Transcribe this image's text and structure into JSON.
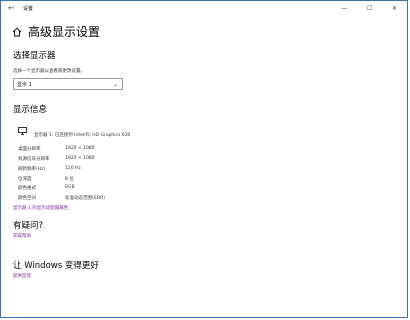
{
  "titlebar": {
    "back_glyph": "←",
    "title": "设置",
    "minimize_glyph": "—",
    "maximize_glyph": "☐",
    "close_glyph": "✕"
  },
  "header": {
    "title": "高级显示设置"
  },
  "select_display": {
    "heading": "选择显示器",
    "hint": "选择一个显示器以查看或更改设置。",
    "selected": "显示 1",
    "chevron": "⌄"
  },
  "display_info": {
    "heading": "显示信息",
    "display_name": "显示器 1: 已连接到 Intel(R) HD Graphics 630",
    "rows": [
      {
        "label": "桌面分辨率",
        "value": "1920 × 1080"
      },
      {
        "label": "有源信号分辨率",
        "value": "1920 × 1080"
      },
      {
        "label": "刷新频率(Hz)",
        "value": "120 Hz"
      },
      {
        "label": "位深度",
        "value": "8 位"
      },
      {
        "label": "颜色格式",
        "value": "RGB"
      },
      {
        "label": "颜色空间",
        "value": "标准动态范围(SDR)"
      }
    ],
    "adapter_link": "显示器 1 的显示适配器属性"
  },
  "help": {
    "heading": "有疑问?",
    "link": "获取帮助"
  },
  "improve": {
    "heading": "让 Windows 变得更好",
    "link": "提供反馈"
  },
  "colors": {
    "link": "#7a2a9b",
    "border": "#3b6fb6"
  }
}
